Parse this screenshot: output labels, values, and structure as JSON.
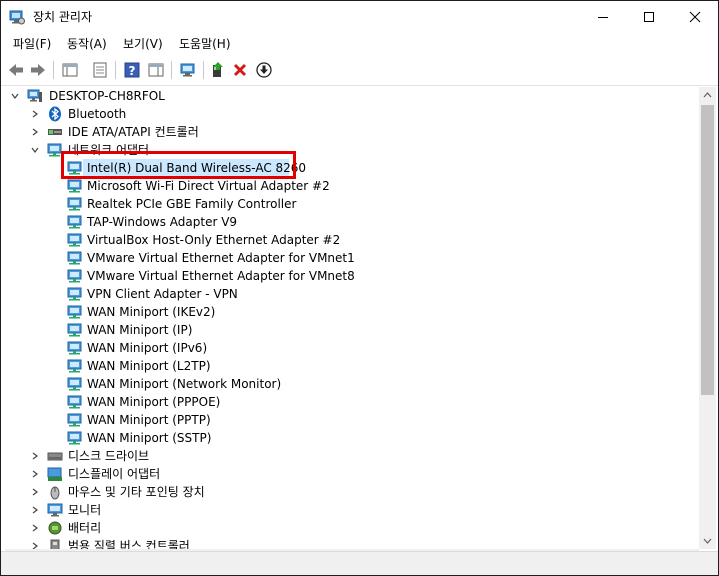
{
  "window": {
    "title": "장치 관리자"
  },
  "menu": [
    "파일(F)",
    "동작(A)",
    "보기(V)",
    "도움말(H)"
  ],
  "toolbar": [
    "back-icon",
    "forward-icon",
    "properties-sheet-icon",
    "show-hidden-icon",
    "help-icon",
    "action-icon",
    "scan-hardware-icon",
    "update-driver-icon",
    "uninstall-icon",
    "download-icon"
  ],
  "tree": {
    "root": "DESKTOP-CH8RFOL",
    "categories_before": [
      {
        "label": "Bluetooth",
        "icon": "bluetooth-icon"
      },
      {
        "label": "IDE ATA/ATAPI 컨트롤러",
        "icon": "ide-controller-icon"
      }
    ],
    "network_category": "네트워크 어댑터",
    "network_adapters": [
      "Intel(R) Dual Band Wireless-AC 8260",
      "Microsoft Wi-Fi Direct Virtual Adapter #2",
      "Realtek PCIe GBE Family Controller",
      "TAP-Windows Adapter V9",
      "VirtualBox Host-Only Ethernet Adapter #2",
      "VMware Virtual Ethernet Adapter for VMnet1",
      "VMware Virtual Ethernet Adapter for VMnet8",
      "VPN Client Adapter - VPN",
      "WAN Miniport (IKEv2)",
      "WAN Miniport (IP)",
      "WAN Miniport (IPv6)",
      "WAN Miniport (L2TP)",
      "WAN Miniport (Network Monitor)",
      "WAN Miniport (PPPOE)",
      "WAN Miniport (PPTP)",
      "WAN Miniport (SSTP)"
    ],
    "categories_after": [
      {
        "label": "디스크 드라이브",
        "icon": "disk-drive-icon"
      },
      {
        "label": "디스플레이 어댑터",
        "icon": "display-adapter-icon"
      },
      {
        "label": "마우스 및 기타 포인팅 장치",
        "icon": "mouse-icon"
      },
      {
        "label": "모니터",
        "icon": "monitor-icon"
      },
      {
        "label": "배터리",
        "icon": "battery-icon"
      },
      {
        "label": "범용 직렬 버스 컨트롤러",
        "icon": "usb-controller-icon"
      }
    ]
  },
  "colors": {
    "highlight_border": "#e10000",
    "selection": "#cce8ff"
  }
}
